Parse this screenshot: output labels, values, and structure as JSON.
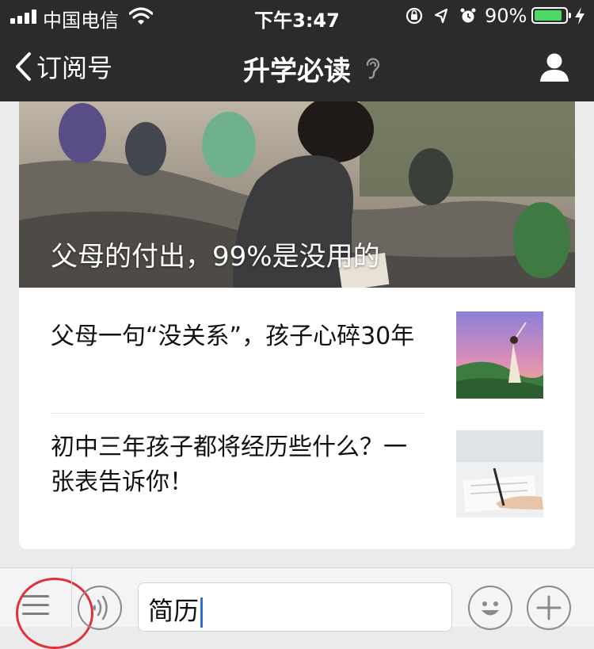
{
  "status_bar": {
    "carrier": "中国电信",
    "time": "下午3:47",
    "battery_percent": "90%",
    "battery_level": 0.9,
    "icons": [
      "signal-icon",
      "wifi-icon",
      "rotation-lock-icon",
      "location-icon",
      "alarm-icon",
      "battery-icon",
      "charging-icon"
    ]
  },
  "nav": {
    "back_label": "订阅号",
    "title": "升学必读",
    "icons": [
      "chevron-left-icon",
      "ear-icon",
      "user-profile-icon"
    ]
  },
  "article": {
    "hero_title": "父母的付出，99%是没用的",
    "items": [
      {
        "title": "父母一句“没关系”，孩子心碎30年"
      },
      {
        "title": "初中三年孩子都将经历些什么？一张表告诉你！"
      }
    ]
  },
  "input_bar": {
    "input_value": "简历",
    "icons": [
      "menu-icon",
      "voice-icon",
      "emoji-icon",
      "plus-icon"
    ]
  },
  "colors": {
    "nav_background": "#2b2b2b",
    "battery_green": "#4cd964",
    "annotation_circle": "#e0303a",
    "caret_blue": "#2f6fd6"
  }
}
